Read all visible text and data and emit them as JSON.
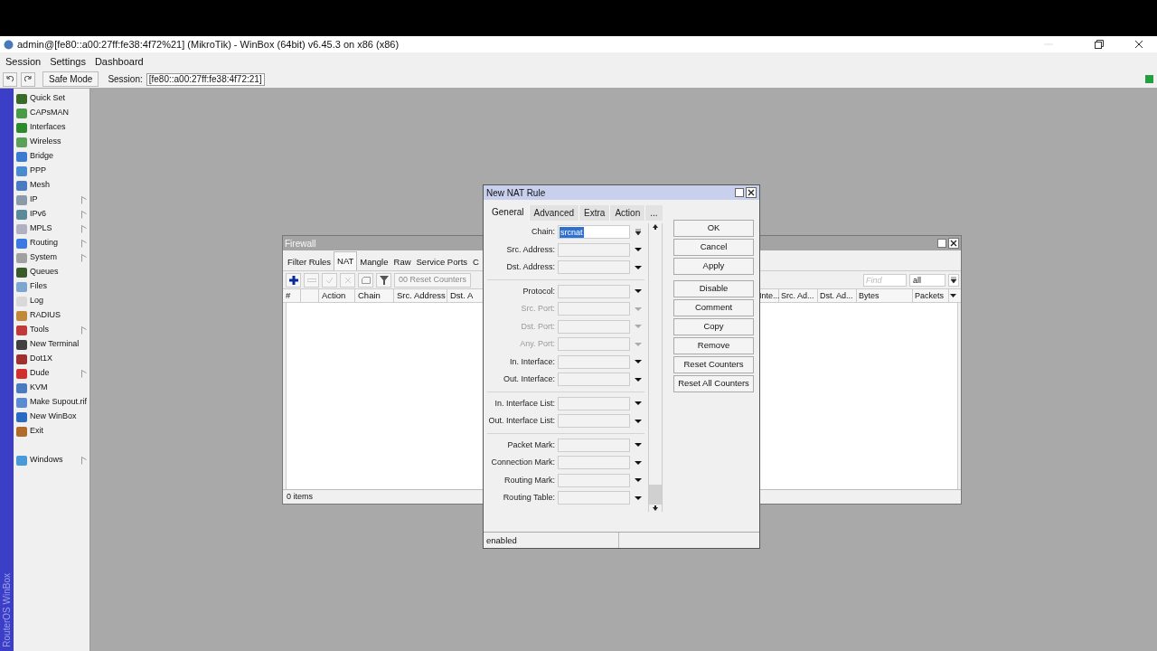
{
  "window": {
    "title": "admin@[fe80::a00:27ff:fe38:4f72%21] (MikroTik) - WinBox (64bit) v6.45.3 on x86 (x86)"
  },
  "menu": [
    "Session",
    "Settings",
    "Dashboard"
  ],
  "toolbar": {
    "safe_mode": "Safe Mode",
    "session_label": "Session:",
    "session_value": "[fe80::a00:27ff:fe38:4f72:21]"
  },
  "sidebar": {
    "brand": "RouterOS WinBox",
    "items": [
      {
        "label": "Quick Set",
        "submenu": false,
        "color": "#3a6a2a"
      },
      {
        "label": "CAPsMAN",
        "submenu": false,
        "color": "#4a9a4a"
      },
      {
        "label": "Interfaces",
        "submenu": false,
        "color": "#2f8a2f"
      },
      {
        "label": "Wireless",
        "submenu": false,
        "color": "#5aa05a"
      },
      {
        "label": "Bridge",
        "submenu": false,
        "color": "#3a7ad0"
      },
      {
        "label": "PPP",
        "submenu": false,
        "color": "#4a8ad0"
      },
      {
        "label": "Mesh",
        "submenu": false,
        "color": "#4a7ac0"
      },
      {
        "label": "IP",
        "submenu": true,
        "color": "#8a9aa8"
      },
      {
        "label": "IPv6",
        "submenu": true,
        "color": "#5a8a9a"
      },
      {
        "label": "MPLS",
        "submenu": true,
        "color": "#b0b0c0"
      },
      {
        "label": "Routing",
        "submenu": true,
        "color": "#3a7ae0"
      },
      {
        "label": "System",
        "submenu": true,
        "color": "#a0a0a0"
      },
      {
        "label": "Queues",
        "submenu": false,
        "color": "#3a5a2a"
      },
      {
        "label": "Files",
        "submenu": false,
        "color": "#7aa6d0"
      },
      {
        "label": "Log",
        "submenu": false,
        "color": "#d8d8d8"
      },
      {
        "label": "RADIUS",
        "submenu": false,
        "color": "#c08a3a"
      },
      {
        "label": "Tools",
        "submenu": true,
        "color": "#c03a3a"
      },
      {
        "label": "New Terminal",
        "submenu": false,
        "color": "#404040"
      },
      {
        "label": "Dot1X",
        "submenu": false,
        "color": "#a03030"
      },
      {
        "label": "Dude",
        "submenu": true,
        "color": "#d03030"
      },
      {
        "label": "KVM",
        "submenu": false,
        "color": "#4a7ac0"
      },
      {
        "label": "Make Supout.rif",
        "submenu": false,
        "color": "#5a8ad0"
      },
      {
        "label": "New WinBox",
        "submenu": false,
        "color": "#2a6ac0"
      },
      {
        "label": "Exit",
        "submenu": false,
        "color": "#b06a2a"
      }
    ],
    "footer_item": {
      "label": "Windows",
      "submenu": true,
      "color": "#4a9ad8"
    }
  },
  "firewall": {
    "title": "Firewall",
    "tabs": [
      {
        "label": "Filter Rules",
        "selected": false
      },
      {
        "label": "NAT",
        "selected": true
      },
      {
        "label": "Mangle",
        "selected": false
      },
      {
        "label": "Raw",
        "selected": false
      },
      {
        "label": "Service Ports",
        "selected": false
      },
      {
        "label": "C",
        "selected": false
      }
    ],
    "reset_counters": "00 Reset Counters",
    "find_placeholder": "Find",
    "filter_value": "all",
    "columns_left": [
      "#",
      "Action",
      "Chain",
      "Src. Address",
      "Dst. A"
    ],
    "columns_right": [
      "Inte...",
      "Src. Ad...",
      "Dst. Ad...",
      "Bytes",
      "Packets"
    ],
    "status": "0 items"
  },
  "dialog": {
    "title": "New NAT Rule",
    "tabs": [
      {
        "label": "General",
        "selected": true
      },
      {
        "label": "Advanced",
        "selected": false
      },
      {
        "label": "Extra",
        "selected": false
      },
      {
        "label": "Action",
        "selected": false
      },
      {
        "label": "...",
        "selected": false
      }
    ],
    "field_groups": [
      [
        {
          "label": "Chain:",
          "value": "srcnat",
          "disabled": false,
          "kind": "combo"
        },
        {
          "label": "Src. Address:",
          "disabled": false,
          "kind": "dropdown"
        },
        {
          "label": "Dst. Address:",
          "disabled": false,
          "kind": "dropdown"
        }
      ],
      [
        {
          "label": "Protocol:",
          "disabled": false,
          "kind": "dropdown"
        },
        {
          "label": "Src. Port:",
          "disabled": true,
          "kind": "dropdown"
        },
        {
          "label": "Dst. Port:",
          "disabled": true,
          "kind": "dropdown"
        },
        {
          "label": "Any. Port:",
          "disabled": true,
          "kind": "dropdown"
        },
        {
          "label": "In. Interface:",
          "disabled": false,
          "kind": "dropdown"
        },
        {
          "label": "Out. Interface:",
          "disabled": false,
          "kind": "dropdown"
        }
      ],
      [
        {
          "label": "In. Interface List:",
          "disabled": false,
          "kind": "dropdown"
        },
        {
          "label": "Out. Interface List:",
          "disabled": false,
          "kind": "dropdown"
        }
      ],
      [
        {
          "label": "Packet Mark:",
          "disabled": false,
          "kind": "dropdown"
        },
        {
          "label": "Connection Mark:",
          "disabled": false,
          "kind": "dropdown"
        },
        {
          "label": "Routing Mark:",
          "disabled": false,
          "kind": "dropdown"
        },
        {
          "label": "Routing Table:",
          "disabled": false,
          "kind": "dropdown"
        }
      ]
    ],
    "buttons": [
      "OK",
      "Cancel",
      "Apply",
      "Disable",
      "Comment",
      "Copy",
      "Remove",
      "Reset Counters",
      "Reset All Counters"
    ],
    "status": "enabled"
  }
}
